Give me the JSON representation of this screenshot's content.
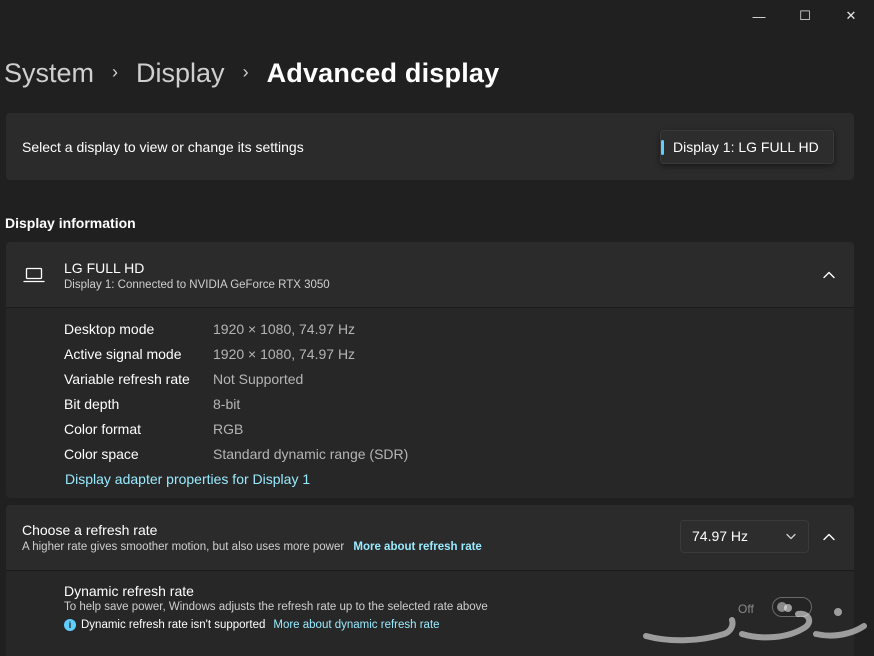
{
  "window_controls": {
    "minimize": "—",
    "maximize": "☐",
    "close": "✕"
  },
  "breadcrumb": {
    "items": [
      "System",
      "Display"
    ],
    "current": "Advanced display",
    "separator": "›"
  },
  "display_selector": {
    "label": "Select a display to view or change its settings",
    "selected": "Display 1: LG FULL HD"
  },
  "display_information": {
    "heading": "Display information",
    "monitor_name": "LG FULL HD",
    "monitor_subtitle": "Display 1: Connected to NVIDIA GeForce RTX 3050",
    "rows": [
      {
        "label": "Desktop mode",
        "value": "1920 × 1080, 74.97 Hz"
      },
      {
        "label": "Active signal mode",
        "value": "1920 × 1080, 74.97 Hz"
      },
      {
        "label": "Variable refresh rate",
        "value": "Not Supported"
      },
      {
        "label": "Bit depth",
        "value": "8-bit"
      },
      {
        "label": "Color format",
        "value": "RGB"
      },
      {
        "label": "Color space",
        "value": "Standard dynamic range (SDR)"
      }
    ],
    "adapter_link": "Display adapter properties for Display 1"
  },
  "refresh_rate": {
    "title": "Choose a refresh rate",
    "description": "A higher rate gives smoother motion, but also uses more power",
    "link": "More about refresh rate",
    "selected": "74.97 Hz"
  },
  "dynamic_refresh": {
    "title": "Dynamic refresh rate",
    "description": "To help save power, Windows adjusts the refresh rate up to the selected rate above",
    "warning": "Dynamic refresh rate isn't supported",
    "warning_icon": "i",
    "link": "More about dynamic refresh rate",
    "toggle_state": "Off"
  },
  "colors": {
    "background": "#202020",
    "card": "#2b2b2b",
    "accent": "#60cdff",
    "link": "#99ebff"
  }
}
